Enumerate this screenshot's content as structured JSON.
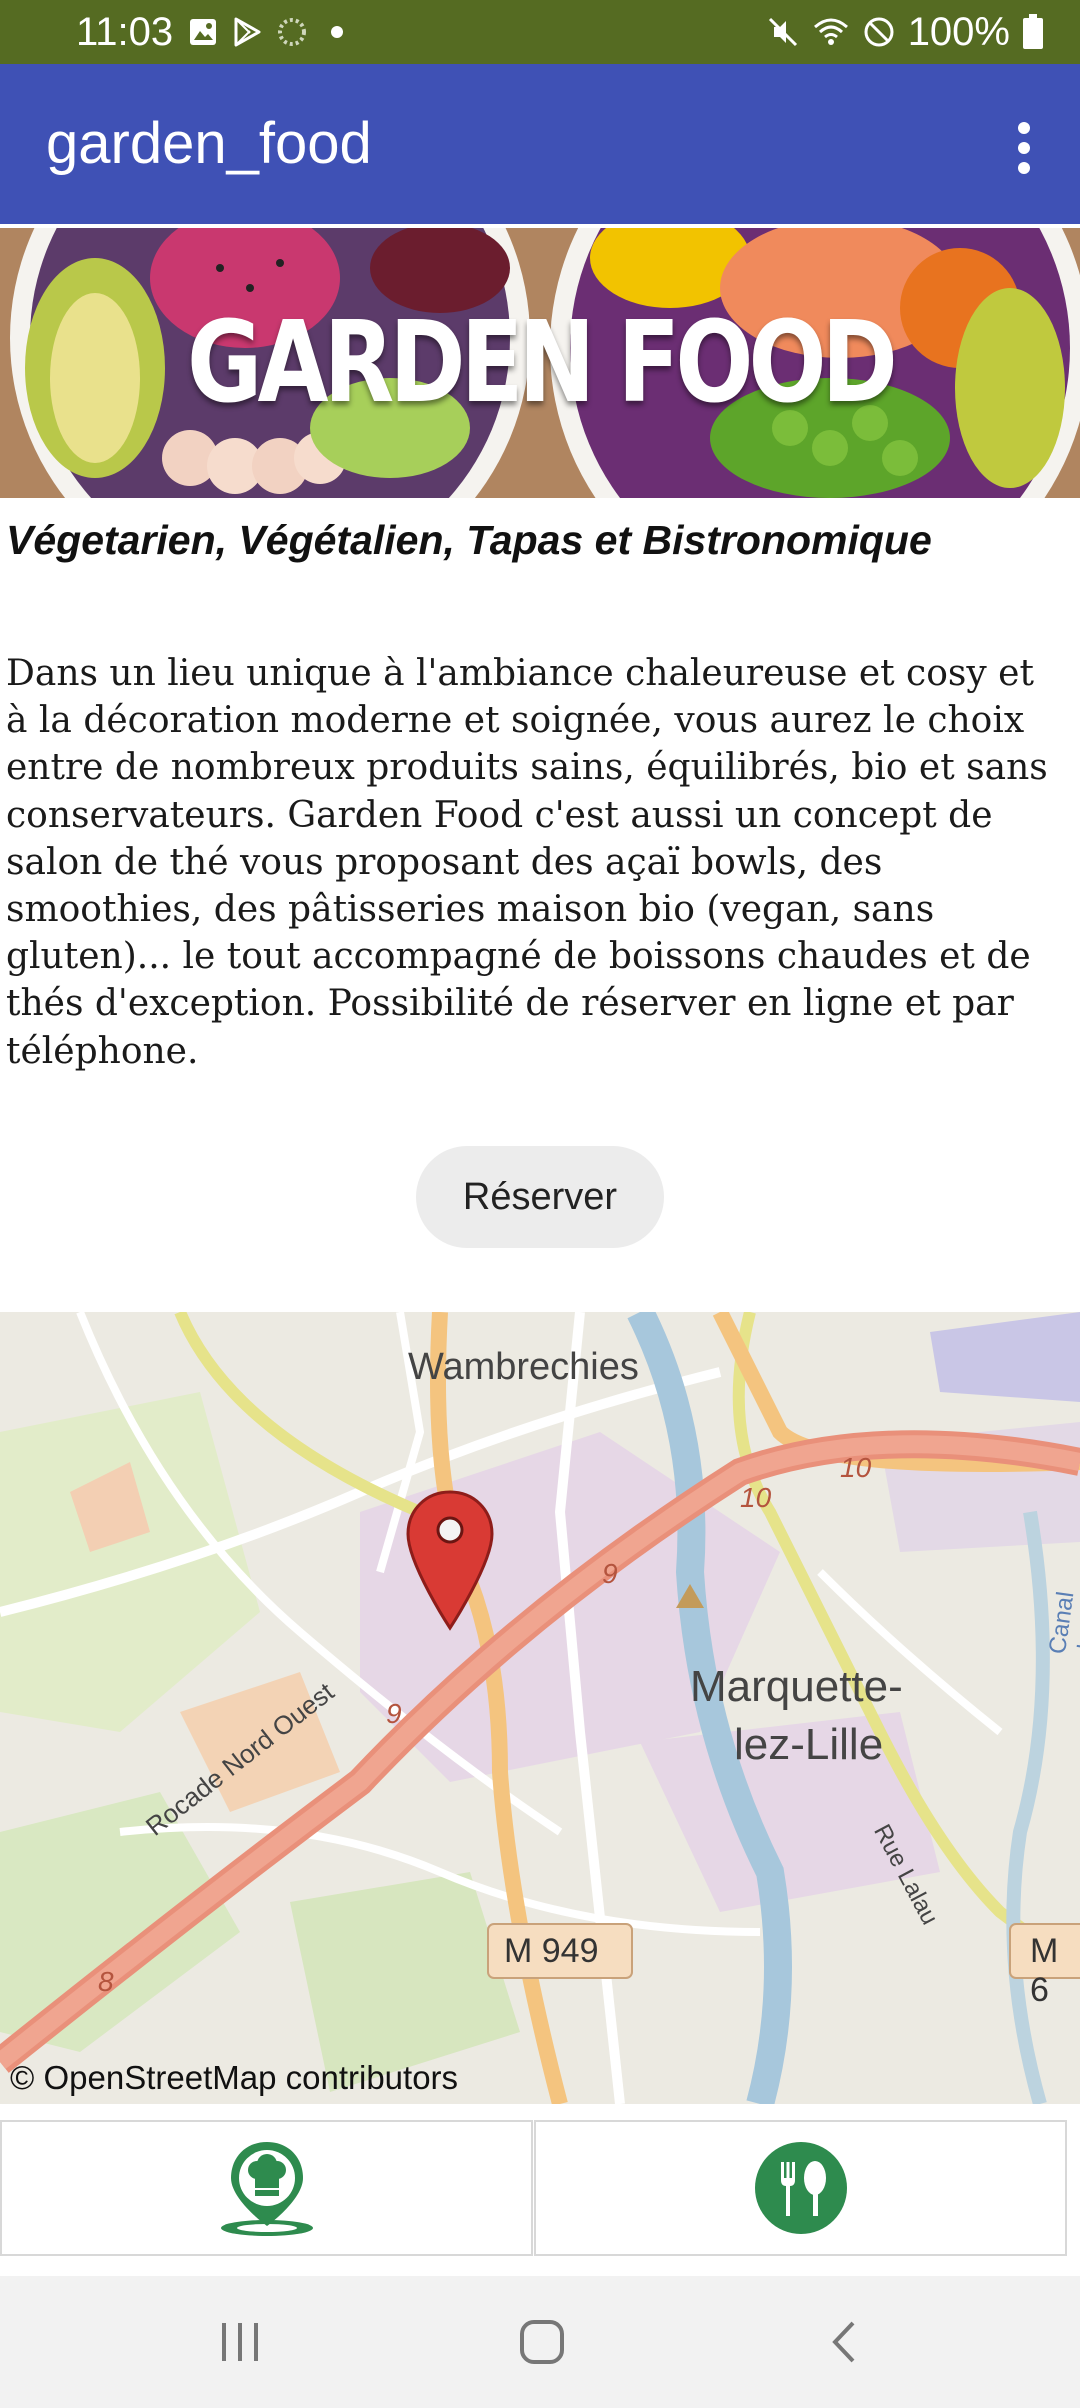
{
  "status_bar": {
    "time": "11:03",
    "battery": "100%"
  },
  "app_bar": {
    "title": "garden_food",
    "overflow_icon": "more-vert-icon"
  },
  "banner": {
    "title": "GARDEN FOOD"
  },
  "content": {
    "subtitle": "Végetarien, Végétalien, Tapas et Bistronomique",
    "description": "Dans un lieu unique à l'ambiance chaleureuse et cosy et à la décoration moderne et soignée, vous aurez le choix entre de nombreux produits sains, équilibrés, bio et sans conservateurs. Garden Food c'est aussi un concept de salon de thé vous proposant des açaï bowls, des smoothies, des pâtisseries maison bio (vegan, sans gluten)... le tout accompagné de boissons chaudes et de thés d'exception. Possibilité de réserver en ligne et par téléphone.",
    "reserve_label": "Réserver"
  },
  "map": {
    "labels": {
      "wambrechies": "Wambrechies",
      "marquette_1": "Marquette-",
      "marquette_2": "lez-Lille",
      "rocade": "Rocade Nord Ouest",
      "m949": "M 949",
      "m_cut": "M 6",
      "rue_lalau": "Rue Lalau",
      "canal": "Canal de Roubaix",
      "r10a": "10",
      "r10b": "10",
      "r9a": "9",
      "r9b": "9",
      "r8": "8"
    },
    "attribution": "© OpenStreetMap contributors",
    "marker_icon": "location-pin-icon"
  },
  "bottom_buttons": {
    "left_icon": "chef-location-icon",
    "right_icon": "restaurant-icon",
    "accent_color": "#2e8b4e"
  },
  "nav_bar": {
    "recents_icon": "recents-icon",
    "home_icon": "home-icon",
    "back_icon": "back-icon"
  }
}
